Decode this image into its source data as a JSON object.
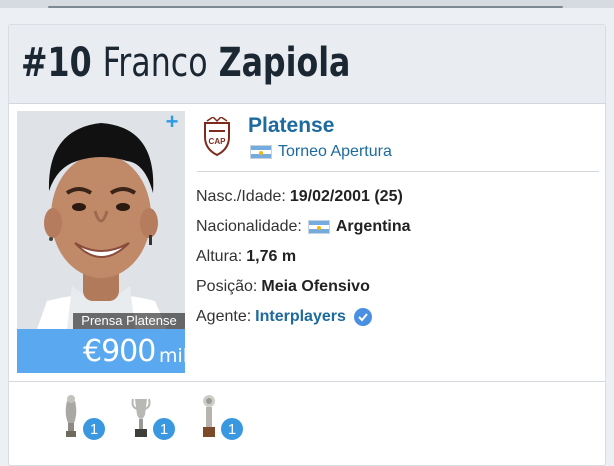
{
  "player": {
    "number": "#10",
    "first_name": "Franco",
    "last_name": "Zapiola",
    "photo_credit": "Prensa Platense",
    "market_value": {
      "amount": "€900",
      "unit": "mil"
    }
  },
  "club": {
    "name": "Platense",
    "league": "Torneo Apertura"
  },
  "details": {
    "birth": {
      "label": "Nasc./Idade:",
      "value": "19/02/2001 (25)"
    },
    "nationality": {
      "label": "Nacionalidade:",
      "value": "Argentina"
    },
    "height": {
      "label": "Altura:",
      "value": "1,76 m"
    },
    "position": {
      "label": "Posição:",
      "value": "Meia Ofensivo"
    },
    "agent": {
      "label": "Agente:",
      "value": "Interplayers"
    }
  },
  "trophies": [
    {
      "icon": "trophy-icon",
      "count": "1"
    },
    {
      "icon": "trophy-icon",
      "count": "1"
    },
    {
      "icon": "trophy-icon",
      "count": "1"
    }
  ],
  "colors": {
    "accent_blue": "#1d6a9e",
    "value_box": "#5aa9f0",
    "badge": "#3a98e0",
    "header_bg": "#e9ecf0"
  }
}
